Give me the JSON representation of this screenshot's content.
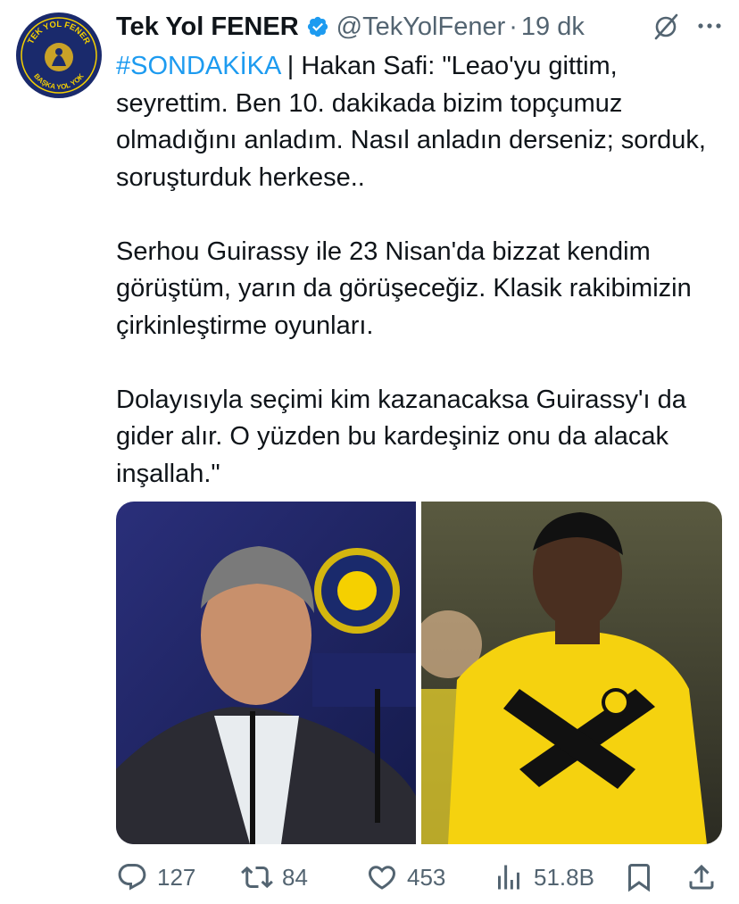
{
  "tweet": {
    "author_name": "Tek Yol FENER",
    "handle": "@TekYolFener",
    "separator": "·",
    "time": "19 dk",
    "avatar_text_top": "TEK YOL FENER",
    "avatar_text_bottom": "BAŞKA YOL YOK",
    "hashtag": "#SONDAKİKA",
    "lines": [
      " | Hakan Safi: \"Leao'yu gittim, seyrettim. Ben 10. dakikada bizim topçumuz olmadığını anladım. Nasıl anladın derseniz; sorduk, soruşturduk herkese..",
      "Serhou Guirassy ile 23 Nisan'da bizzat kendim görüştüm, yarın da görüşeceğiz. Klasik rakibimizin çirkinleştirme oyunları.",
      "Dolayısıyla seçimi kim kazanacaksa Guirassy'ı da gider alır. O yüzden bu kardeşiniz onu da alacak inşallah.\""
    ]
  },
  "stats": {
    "replies": "127",
    "retweets": "84",
    "likes": "453",
    "views": "51.8B"
  },
  "icons": {
    "verified": "verified-badge-icon",
    "grok": "grok-icon",
    "more": "more-icon",
    "reply": "reply-icon",
    "retweet": "retweet-icon",
    "like": "heart-icon",
    "views": "views-icon",
    "bookmark": "bookmark-icon",
    "share": "share-icon"
  },
  "colors": {
    "link": "#1d9bf0",
    "text": "#0f1419",
    "secondary": "#536471",
    "verified": "#1d9bf0",
    "avatar_bg": "#1a2a6c",
    "avatar_text": "#f5d000"
  }
}
